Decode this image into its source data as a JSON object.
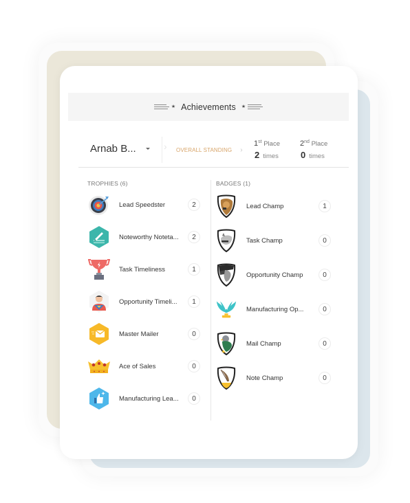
{
  "header": {
    "title": "Achievements"
  },
  "standing": {
    "user_name": "Arnab B...",
    "overall_label": "OVERALL STANDING",
    "first_place": {
      "ordinal": "1",
      "suffix": "st",
      "label": "Place",
      "count": "2",
      "unit": "times"
    },
    "second_place": {
      "ordinal": "2",
      "suffix": "nd",
      "label": "Place",
      "count": "0",
      "unit": "times"
    }
  },
  "trophies": {
    "title": "TROPHIES (6)",
    "items": [
      {
        "label": "Lead Speedster",
        "count": "2",
        "icon": "target-icon"
      },
      {
        "label": "Noteworthy Noteta...",
        "count": "2",
        "icon": "note-pen-icon"
      },
      {
        "label": "Task Timeliness",
        "count": "1",
        "icon": "trophy-cup-icon"
      },
      {
        "label": "Opportunity Timeli...",
        "count": "1",
        "icon": "superhero-icon"
      },
      {
        "label": "Master Mailer",
        "count": "0",
        "icon": "mail-icon"
      },
      {
        "label": "Ace of Sales",
        "count": "0",
        "icon": "crown-icon"
      },
      {
        "label": "Manufacturing Lea...",
        "count": "0",
        "icon": "thumbs-up-icon"
      }
    ]
  },
  "badges": {
    "title": "BADGES (1)",
    "items": [
      {
        "label": "Lead Champ",
        "count": "1",
        "icon": "lion-shield-icon"
      },
      {
        "label": "Task Champ",
        "count": "0",
        "icon": "rhino-shield-icon"
      },
      {
        "label": "Opportunity Champ",
        "count": "0",
        "icon": "cobra-shield-icon"
      },
      {
        "label": "Manufacturing Op...",
        "count": "0",
        "icon": "wings-trophy-icon"
      },
      {
        "label": "Mail Champ",
        "count": "0",
        "icon": "pigeon-shield-icon"
      },
      {
        "label": "Note Champ",
        "count": "0",
        "icon": "quill-shield-icon"
      }
    ]
  },
  "colors": {
    "accent_orange": "#d8a56a",
    "back_card": "#ebe7d9",
    "front_back_card": "#dce6ec",
    "header_bg": "#f5f5f5"
  }
}
